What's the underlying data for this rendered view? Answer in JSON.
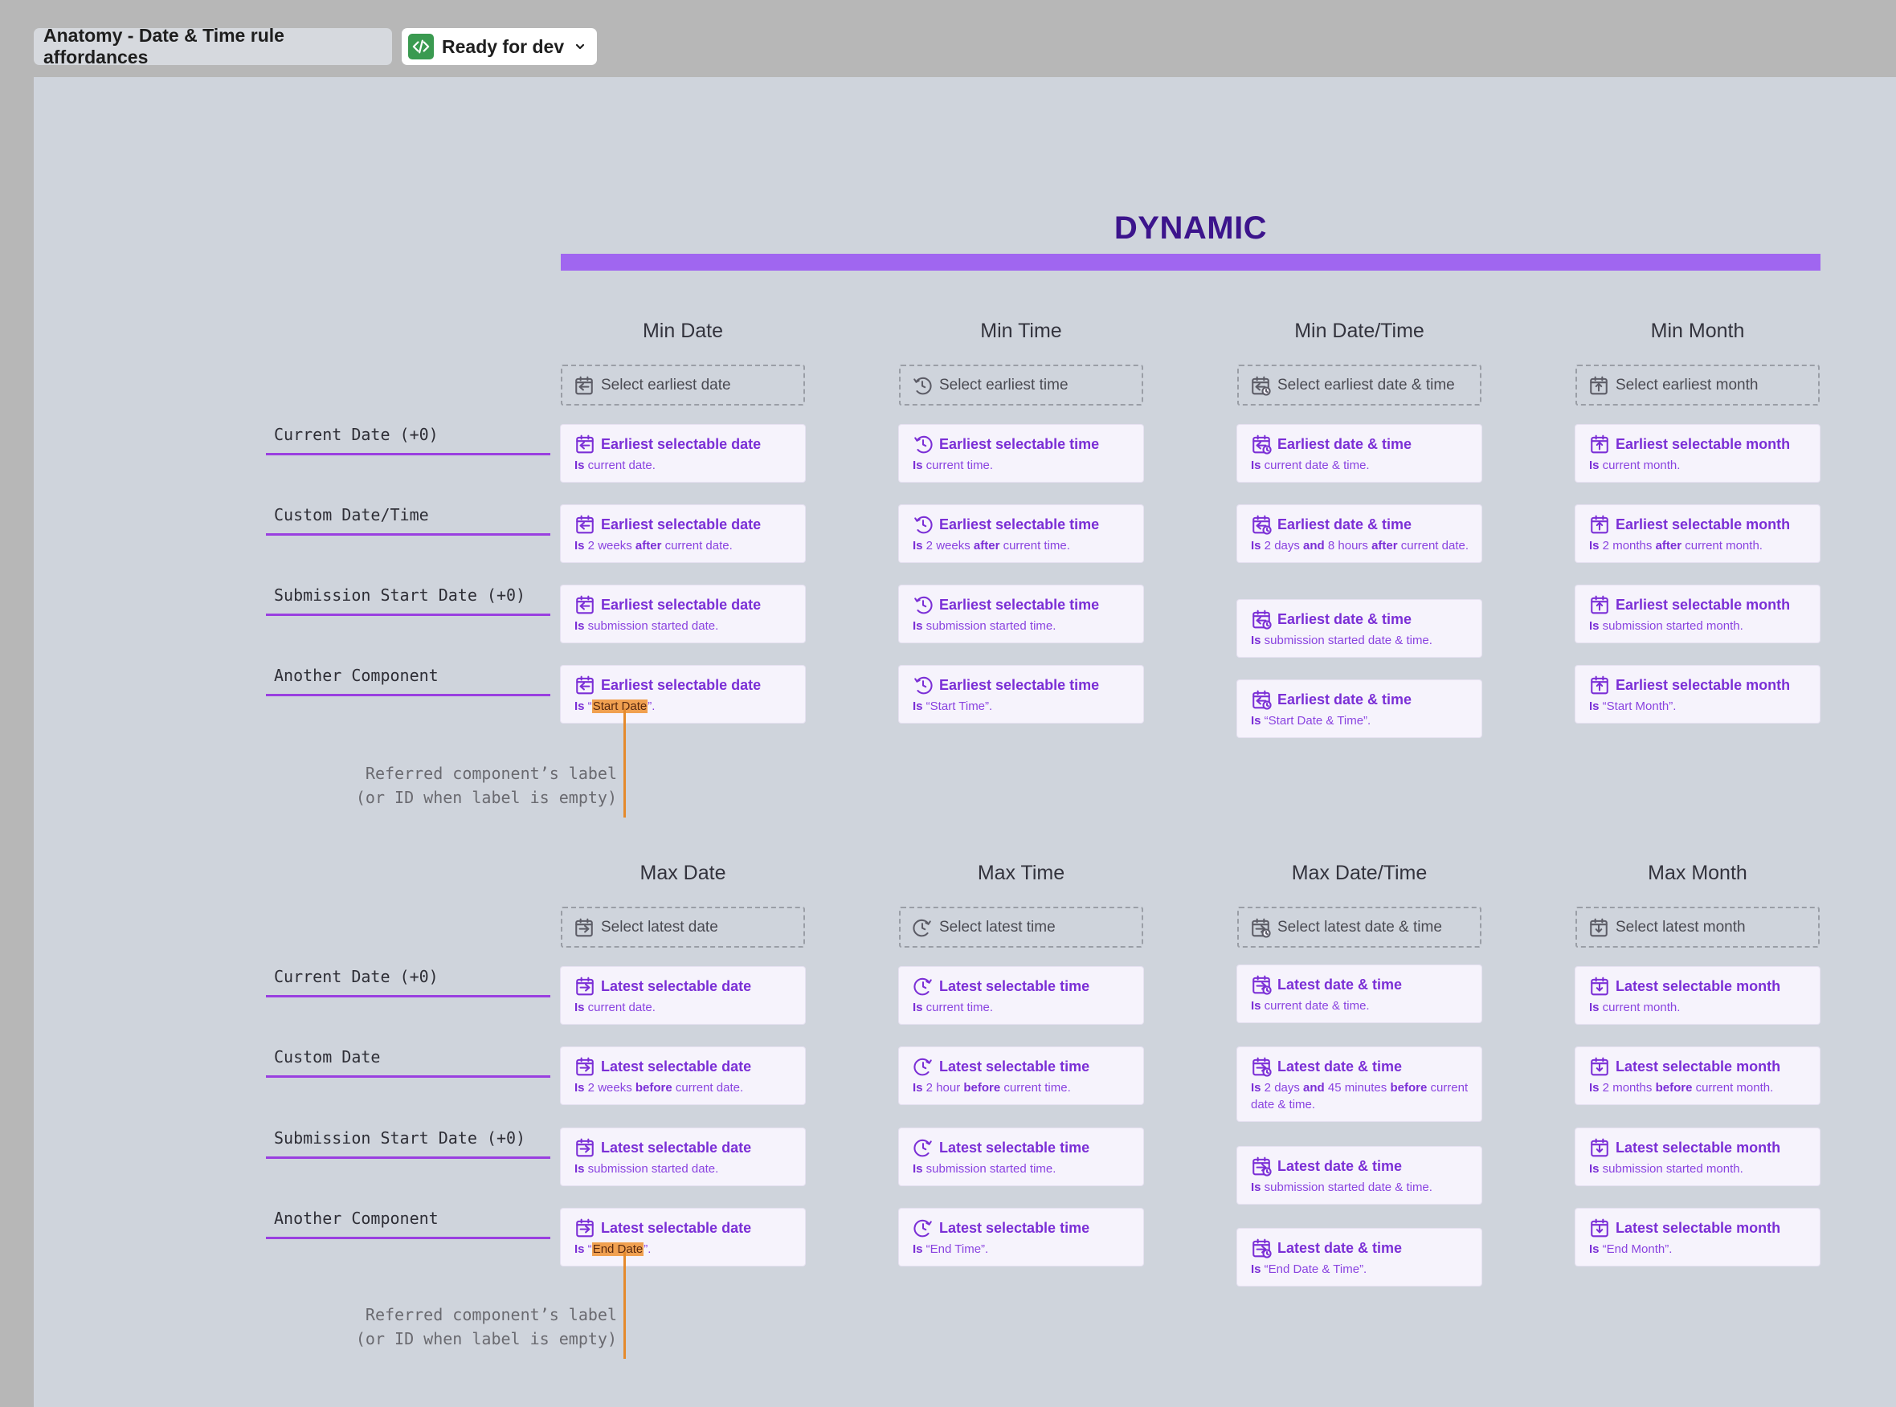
{
  "toolbar": {
    "title": "Anatomy - Date & Time rule affordances",
    "status": "Ready for dev",
    "status_color": "#3a9a50"
  },
  "banner": {
    "title": "DYNAMIC",
    "bar_color": "#a066f0",
    "title_color": "#3c148c"
  },
  "min_section": {
    "row_labels": [
      "Current Date (+0)",
      "Custom Date/Time",
      "Submission Start Date (+0)",
      "Another Component"
    ],
    "columns": [
      {
        "header": "Min Date",
        "placeholder": "Select earliest date",
        "icon": "calendar-min-icon",
        "cards": [
          {
            "title": "Earliest selectable date",
            "is": "Is",
            "body": " current date."
          },
          {
            "title": "Earliest selectable date",
            "is": "Is",
            "p1": " 2 weeks ",
            "kw1": "after",
            "p2": " current date."
          },
          {
            "title": "Earliest selectable date",
            "is": "Is",
            "body": " submission started date."
          },
          {
            "title": "Earliest selectable date",
            "is": "Is",
            "pre": " “",
            "ref": "Start Date",
            "post": "”."
          }
        ]
      },
      {
        "header": "Min Time",
        "placeholder": "Select earliest time",
        "icon": "clock-min-icon",
        "cards": [
          {
            "title": "Earliest selectable time",
            "is": "Is",
            "body": " current time."
          },
          {
            "title": "Earliest selectable time",
            "is": "Is",
            "p1": " 2 weeks ",
            "kw1": "after",
            "p2": " current time."
          },
          {
            "title": "Earliest selectable time",
            "is": "Is",
            "body": " submission started time."
          },
          {
            "title": "Earliest selectable time",
            "is": "Is",
            "body": " “Start Time”."
          }
        ]
      },
      {
        "header": "Min Date/Time",
        "placeholder": "Select earliest date & time",
        "icon": "calendar-clock-min-icon",
        "cards": [
          {
            "title": "Earliest date & time",
            "is": "Is",
            "body": " current date & time."
          },
          {
            "title": "Earliest date & time",
            "is": "Is",
            "p1": " 2 days ",
            "kw1": "and",
            "p2": " 8 hours ",
            "kw2": "after",
            "p3": " current date."
          },
          {
            "title": "Earliest date & time",
            "is": "Is",
            "body": " submission started date & time."
          },
          {
            "title": "Earliest date & time",
            "is": "Is",
            "body": " “Start Date & Time”."
          }
        ]
      },
      {
        "header": "Min Month",
        "placeholder": "Select earliest month",
        "icon": "calendar-month-min-icon",
        "cards": [
          {
            "title": "Earliest selectable month",
            "is": "Is",
            "body": " current month."
          },
          {
            "title": "Earliest selectable month",
            "is": "Is",
            "p1": " 2 months ",
            "kw1": "after",
            "p2": " current month."
          },
          {
            "title": "Earliest selectable month",
            "is": "Is",
            "body": " submission started month."
          },
          {
            "title": "Earliest selectable month",
            "is": "Is",
            "body": " “Start Month”."
          }
        ]
      }
    ],
    "annotation": [
      "Referred component’s label",
      "(or ID when label is empty)"
    ]
  },
  "max_section": {
    "row_labels": [
      "Current Date (+0)",
      "Custom Date",
      "Submission Start Date (+0)",
      "Another Component"
    ],
    "columns": [
      {
        "header": "Max Date",
        "placeholder": "Select latest date",
        "icon": "calendar-max-icon",
        "cards": [
          {
            "title": "Latest selectable date",
            "is": "Is",
            "body": " current date."
          },
          {
            "title": "Latest selectable date",
            "is": "Is",
            "p1": " 2 weeks ",
            "kw1": "before",
            "p2": " current date."
          },
          {
            "title": "Latest selectable date",
            "is": "Is",
            "body": " submission started date."
          },
          {
            "title": "Latest selectable date",
            "is": "Is",
            "pre": " “",
            "ref": "End Date",
            "post": "”."
          }
        ]
      },
      {
        "header": "Max Time",
        "placeholder": "Select latest time",
        "icon": "clock-max-icon",
        "cards": [
          {
            "title": "Latest selectable time",
            "is": "Is",
            "body": " current time."
          },
          {
            "title": "Latest selectable time",
            "is": "Is",
            "p1": " 2 hour ",
            "kw1": "before",
            "p2": " current time."
          },
          {
            "title": "Latest selectable time",
            "is": "Is",
            "body": " submission started time."
          },
          {
            "title": "Latest selectable time",
            "is": "Is",
            "body": " “End Time”."
          }
        ]
      },
      {
        "header": "Max Date/Time",
        "placeholder": "Select latest date & time",
        "icon": "calendar-clock-max-icon",
        "cards": [
          {
            "title": "Latest date & time",
            "is": "Is",
            "body": " current date & time."
          },
          {
            "title": "Latest date & time",
            "is": "Is",
            "p1": " 2 days ",
            "kw1": "and",
            "p2": " 45 minutes ",
            "kw2": "before",
            "p3": " current date & time."
          },
          {
            "title": "Latest date & time",
            "is": "Is",
            "body": " submission started date & time."
          },
          {
            "title": "Latest date & time",
            "is": "Is",
            "body": " “End Date & Time”."
          }
        ]
      },
      {
        "header": "Max Month",
        "placeholder": "Select latest month",
        "icon": "calendar-month-max-icon",
        "cards": [
          {
            "title": "Latest selectable month",
            "is": "Is",
            "body": " current month."
          },
          {
            "title": "Latest selectable month",
            "is": "Is",
            "p1": " 2 months ",
            "kw1": "before",
            "p2": " current month."
          },
          {
            "title": "Latest selectable month",
            "is": "Is",
            "body": " submission started month."
          },
          {
            "title": "Latest selectable month",
            "is": "Is",
            "body": " “End Month”."
          }
        ]
      }
    ],
    "annotation": [
      "Referred component’s label",
      "(or ID when label is empty)"
    ]
  }
}
